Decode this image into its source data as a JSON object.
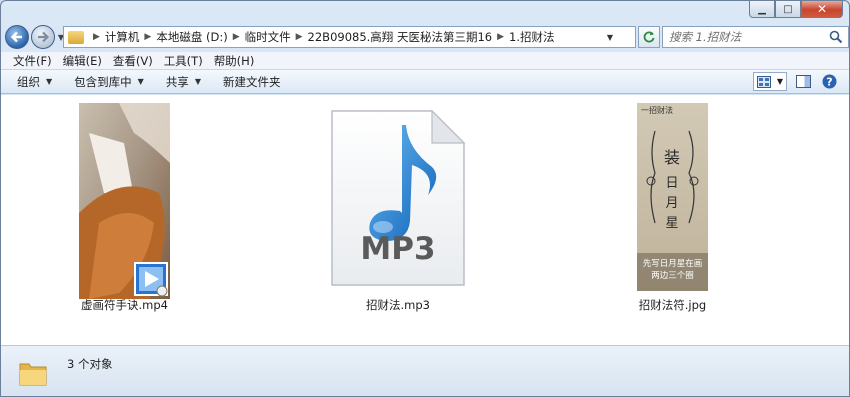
{
  "caption": {
    "min": "▁",
    "max": "□",
    "close": "✕"
  },
  "address": {
    "crumbs": [
      "计算机",
      "本地磁盘 (D:)",
      "临时文件",
      "22B09085.高翔 天医秘法第三期16",
      "1.招财法"
    ]
  },
  "search": {
    "placeholder": "搜索 1.招财法"
  },
  "menu": {
    "items": [
      "文件(F)",
      "编辑(E)",
      "查看(V)",
      "工具(T)",
      "帮助(H)"
    ]
  },
  "toolbar": {
    "organize": "组织",
    "include_library": "包含到库中",
    "share": "共享",
    "new_folder": "新建文件夹"
  },
  "files": [
    {
      "name": "虚画符手诀.mp4",
      "type": "video"
    },
    {
      "name": "招财法.mp3",
      "type": "audio",
      "badge": "MP3"
    },
    {
      "name": "招财法符.jpg",
      "type": "image",
      "caption_lines": [
        "先写日月星在画",
        "两边三个圈"
      ]
    }
  ],
  "talisman": {
    "header": "一招财法"
  },
  "status": {
    "count": "3 个对象"
  },
  "colors": {
    "accent": "#2b64ad",
    "mp3_note": "#1f7fd4"
  }
}
